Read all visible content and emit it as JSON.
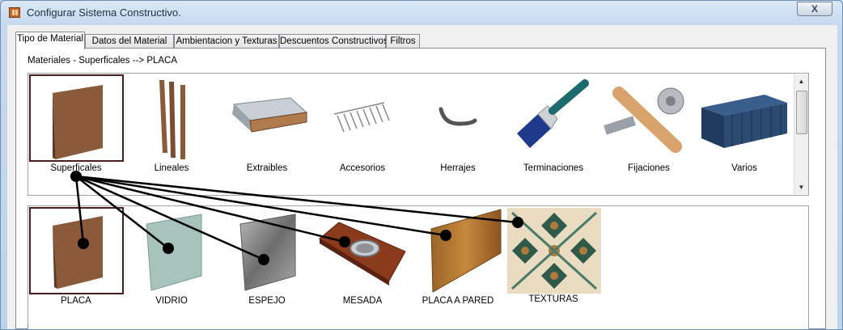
{
  "window": {
    "title": "Configurar Sistema Constructivo.",
    "close_label": "X"
  },
  "tabs": [
    {
      "label": "Tipo de Material",
      "active": true
    },
    {
      "label": "Datos del Material",
      "active": false
    },
    {
      "label": "Ambientacion y Texturas",
      "active": false
    },
    {
      "label": "Descuentos Constructivos",
      "active": false
    },
    {
      "label": "Filtros",
      "active": false
    }
  ],
  "breadcrumb": "Materiales - Superficales --> PLACA",
  "categories": [
    {
      "label": "Superficales",
      "icon": "board-icon",
      "selected": true
    },
    {
      "label": "Lineales",
      "icon": "planks-icon",
      "selected": false
    },
    {
      "label": "Extraibles",
      "icon": "drawer-icon",
      "selected": false
    },
    {
      "label": "Accesorios",
      "icon": "hangers-icon",
      "selected": false
    },
    {
      "label": "Herrajes",
      "icon": "handle-icon",
      "selected": false
    },
    {
      "label": "Terminaciones",
      "icon": "paintbrush-icon",
      "selected": false
    },
    {
      "label": "Fijaciones",
      "icon": "fastener-icon",
      "selected": false
    },
    {
      "label": "Varios",
      "icon": "container-icon",
      "selected": false
    }
  ],
  "subtypes": [
    {
      "label": "PLACA",
      "icon": "board-icon",
      "selected": true
    },
    {
      "label": "VIDRIO",
      "icon": "glass-icon",
      "selected": false
    },
    {
      "label": "ESPEJO",
      "icon": "mirror-icon",
      "selected": false
    },
    {
      "label": "MESADA",
      "icon": "countertop-icon",
      "selected": false
    },
    {
      "label": "PLACA A PARED",
      "icon": "wall-panel-icon",
      "selected": false
    },
    {
      "label": "TEXTURAS",
      "icon": "tile-texture-icon",
      "selected": false
    }
  ],
  "colors": {
    "selection_border": "#4a1e1e",
    "wood": "#8a5a3a",
    "connector": "#000000"
  }
}
